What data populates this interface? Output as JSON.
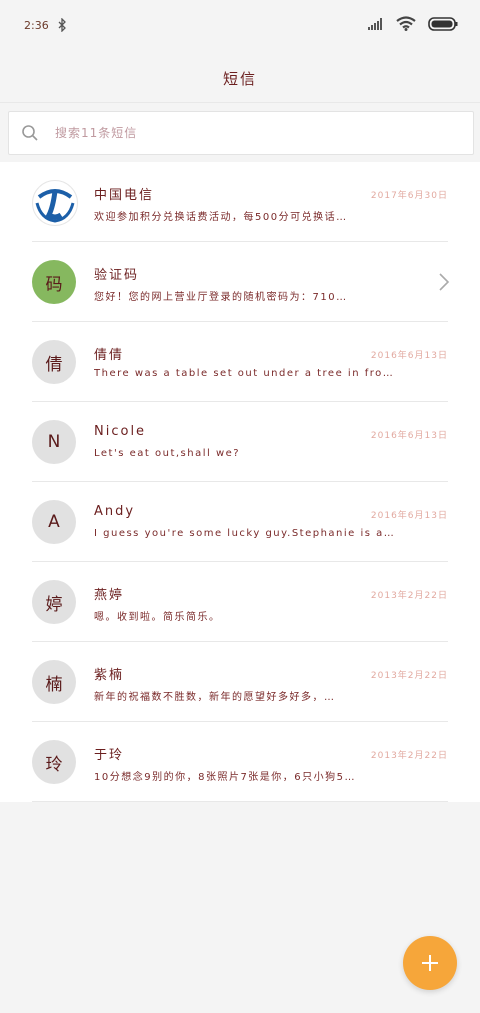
{
  "status_bar": {
    "time": "2:36"
  },
  "header": {
    "title": "短信"
  },
  "search": {
    "placeholder": "搜索11条短信"
  },
  "conversations": [
    {
      "name": "中国电信",
      "avatar": "",
      "date": "2017年6月30日",
      "preview": "欢迎参加积分兑换话费活动，每500分可兑换话…"
    },
    {
      "name": "验证码",
      "avatar": "码",
      "date": "",
      "preview": "您好！您的网上营业厅登录的随机密码为：710…"
    },
    {
      "name": "倩倩",
      "avatar": "倩",
      "date": "2016年6月13日",
      "preview": "There was a table set out under a tree in front …"
    },
    {
      "name": "Nicole",
      "avatar": "N",
      "date": "2016年6月13日",
      "preview": "Let's eat out,shall we?"
    },
    {
      "name": "Andy",
      "avatar": "A",
      "date": "2016年6月13日",
      "preview": "I guess you're some lucky guy.Stephanie is a ni…"
    },
    {
      "name": "燕婷",
      "avatar": "婷",
      "date": "2013年2月22日",
      "preview": "嗯。收到啦。简乐简乐。"
    },
    {
      "name": "紫楠",
      "avatar": "楠",
      "date": "2013年2月22日",
      "preview": "新年的祝福数不胜数，新年的愿望好多好多，…"
    },
    {
      "name": "于玲",
      "avatar": "玲",
      "date": "2013年2月22日",
      "preview": "10分想念9别的你，8张照片7张是你，6只小狗5…"
    }
  ],
  "colors": {
    "accent": "#f6a63a",
    "text_dark_red": "#6b1f1f",
    "telecom_blue": "#1c5fa8",
    "verify_green": "#86b85f"
  },
  "icons": {
    "search": "search-icon",
    "add": "plus-icon",
    "chevron": "chevron-right-icon"
  }
}
